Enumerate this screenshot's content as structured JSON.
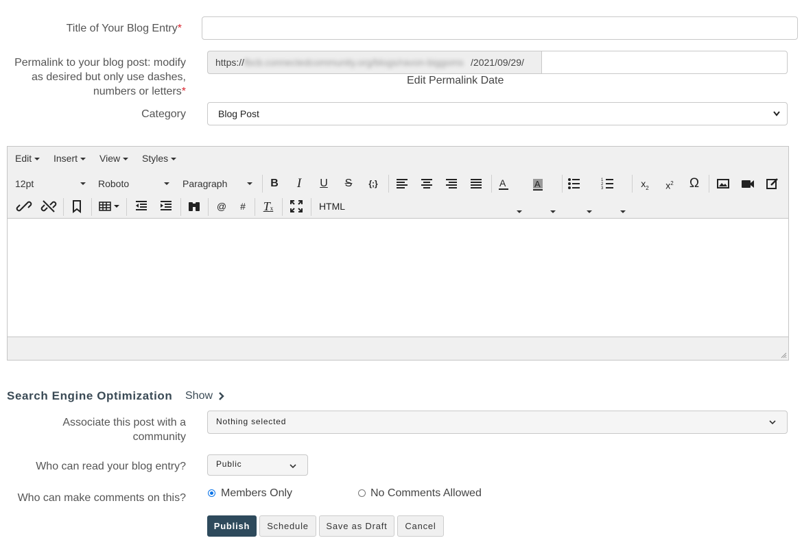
{
  "form": {
    "title_label": "Title of Your Blog Entry",
    "required_mark": "*",
    "title_value": "",
    "permalink_label_l1": "Permalink to your blog post: modify",
    "permalink_label_l2": "as desired but only use dashes,",
    "permalink_label_l3": "numbers or letters",
    "permalink_prefix": "https://",
    "permalink_blurred": "fbcb.connectedcommunity.org/blogs/ravon-biggoms",
    "permalink_date": "/2021/09/29/",
    "permalink_slug": "",
    "edit_permalink_date": "Edit Permalink Date",
    "category_label": "Category",
    "category_value": "Blog Post"
  },
  "editor": {
    "menus": [
      "Edit",
      "Insert",
      "View",
      "Styles"
    ],
    "font_size": "12pt",
    "font_family": "Roboto",
    "block_format": "Paragraph",
    "html_button": "HTML",
    "icons": [
      "bold",
      "italic",
      "underline",
      "strikethrough",
      "code-sample",
      "align-left",
      "align-center",
      "align-right",
      "justify",
      "text-color",
      "background-color",
      "bullet-list",
      "numbered-list",
      "subscript",
      "superscript",
      "special-character",
      "image",
      "video",
      "edit",
      "link",
      "unlink",
      "bookmark",
      "table",
      "outdent",
      "indent",
      "find-replace",
      "mention",
      "hashtag",
      "clear-formatting",
      "fullscreen"
    ]
  },
  "seo": {
    "heading": "Search Engine Optimization",
    "toggle": "Show"
  },
  "community": {
    "label_l1": "Associate this post with a",
    "label_l2": "community",
    "value": "Nothing selected"
  },
  "visibility": {
    "label": "Who can read your blog entry?",
    "value": "Public"
  },
  "comments": {
    "label": "Who can make comments on this?",
    "options": [
      "Members Only",
      "No Comments Allowed"
    ],
    "selected": "Members Only"
  },
  "actions": {
    "publish": "Publish",
    "schedule": "Schedule",
    "draft": "Save as Draft",
    "cancel": "Cancel"
  },
  "colors": {
    "publish_bg": "#2e4a5c",
    "required": "#d9232e",
    "radio_accent": "#0a73e8"
  }
}
